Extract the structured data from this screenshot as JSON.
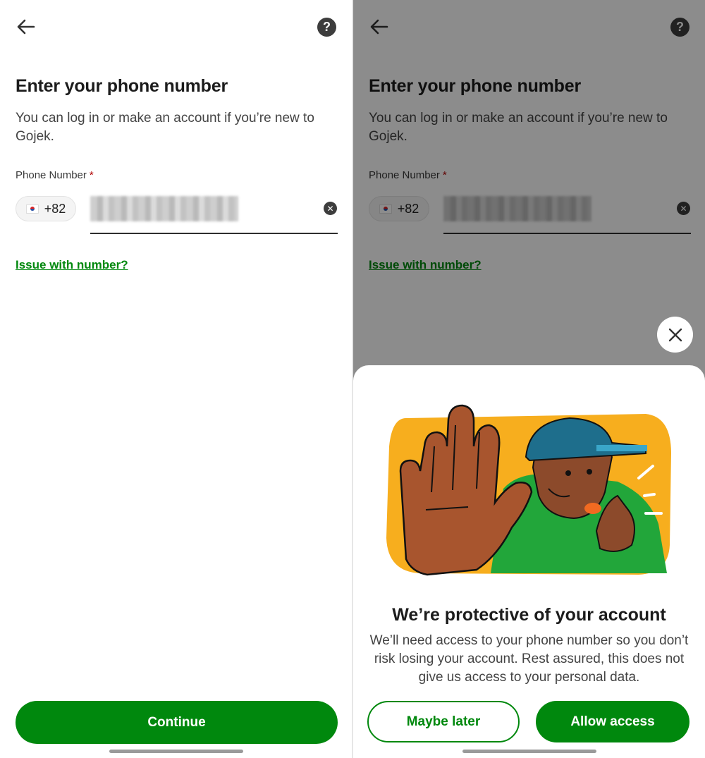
{
  "login": {
    "title": "Enter your phone number",
    "subtitle": "You can log in or make an account if you’re new to Gojek.",
    "phone_label": "Phone Number",
    "required_mark": "*",
    "country_code": "+82",
    "help_symbol": "?",
    "clear_symbol": "✕",
    "issue_link": "Issue with number?",
    "continue_label": "Continue"
  },
  "permission_sheet": {
    "title": "We’re protective of your account",
    "body": "We’ll need access to your phone number so you don’t risk losing your account. Rest assured, this does not give us access to your personal data.",
    "maybe_later_label": "Maybe later",
    "allow_label": "Allow access"
  },
  "icons": {
    "back": "arrow-left-icon",
    "help": "question-circle-icon",
    "clear": "clear-circle-icon",
    "close": "close-icon",
    "flag": "south-korea-flag-icon"
  },
  "colors": {
    "brand_green": "#00880D",
    "link_green": "#00880D",
    "required_red": "#B00000",
    "illustration_yellow": "#F7AE1E",
    "illustration_shirt": "#22A63A",
    "illustration_cap": "#1E6E8C"
  }
}
